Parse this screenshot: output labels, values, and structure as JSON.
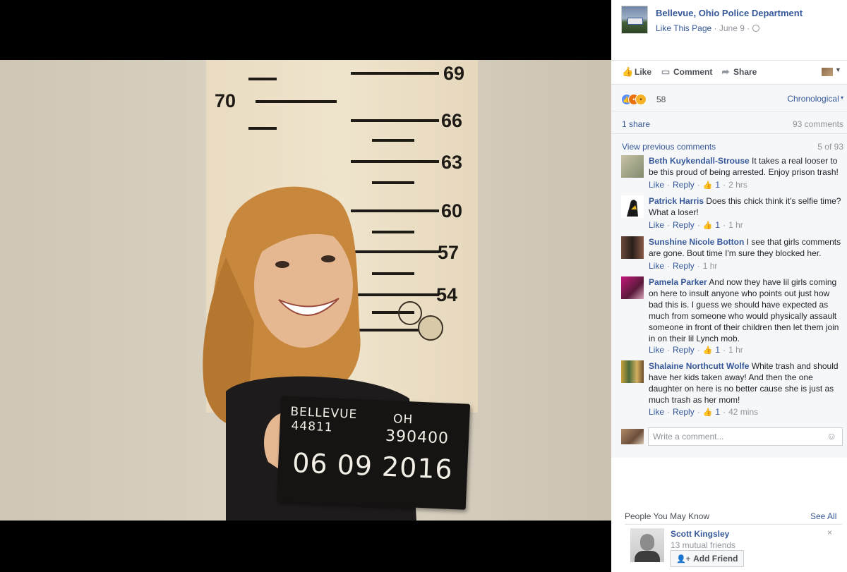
{
  "post": {
    "page_name": "Bellevue, Ohio Police Department",
    "like_page": "Like This Page",
    "date": "June 9",
    "separator": "·",
    "privacy_icon": "globe-icon"
  },
  "photo": {
    "chart_numbers": {
      "n69": "69",
      "n70": "70",
      "n66": "66",
      "n63": "63",
      "n60": "60",
      "n57": "57",
      "n54": "54"
    },
    "placard": {
      "city": "BELLEVUE",
      "zip": "44811",
      "state": "OH",
      "number": "390400",
      "date": "06 09 2016"
    }
  },
  "actions": {
    "like": "Like",
    "comment": "Comment",
    "share": "Share"
  },
  "reactions": {
    "count": "58",
    "sort": "Chronological"
  },
  "shares": {
    "count": "1 share",
    "comments": "93 comments"
  },
  "comments_nav": {
    "view_previous": "View previous comments",
    "position": "5 of 93"
  },
  "comments": [
    {
      "author": "Beth Kuykendall-Strouse",
      "text": "It takes a real looser to be this proud of being arrested. Enjoy prison trash!",
      "like": "Like",
      "reply": "Reply",
      "likes": "1",
      "time": "2 hrs"
    },
    {
      "author": "Patrick Harris",
      "text": "Does this chick think it's selfie time? What a loser!",
      "like": "Like",
      "reply": "Reply",
      "likes": "1",
      "time": "1 hr"
    },
    {
      "author": "Sunshine Nicole Botton",
      "text": "I see that girls comments are gone. Bout time I'm sure they blocked her.",
      "like": "Like",
      "reply": "Reply",
      "time": "1 hr"
    },
    {
      "author": "Pamela Parker",
      "text": "And now they have lil girls coming on here to insult anyone who points out just how bad this is. I guess we should have expected as much from someone who would physically assault someone in front of their children then let them join in on their lil Lynch mob.",
      "like": "Like",
      "reply": "Reply",
      "likes": "1",
      "time": "1 hr"
    },
    {
      "author": "Shalaine Northcutt Wolfe",
      "text": "White trash and should have her kids taken away! And then the one daughter on here is no better cause she is just as much trash as her mom!",
      "like": "Like",
      "reply": "Reply",
      "likes": "1",
      "time": "42 mins"
    }
  ],
  "composer": {
    "placeholder": "Write a comment..."
  },
  "people_you_may_know": {
    "title": "People You May Know",
    "see_all": "See All",
    "name": "Scott Kingsley",
    "mutual": "13 mutual friends",
    "add_friend": "Add Friend",
    "dismiss": "×"
  },
  "colors": {
    "link": "#365899",
    "muted": "#90949c",
    "panel_bg": "#f6f7f9"
  }
}
